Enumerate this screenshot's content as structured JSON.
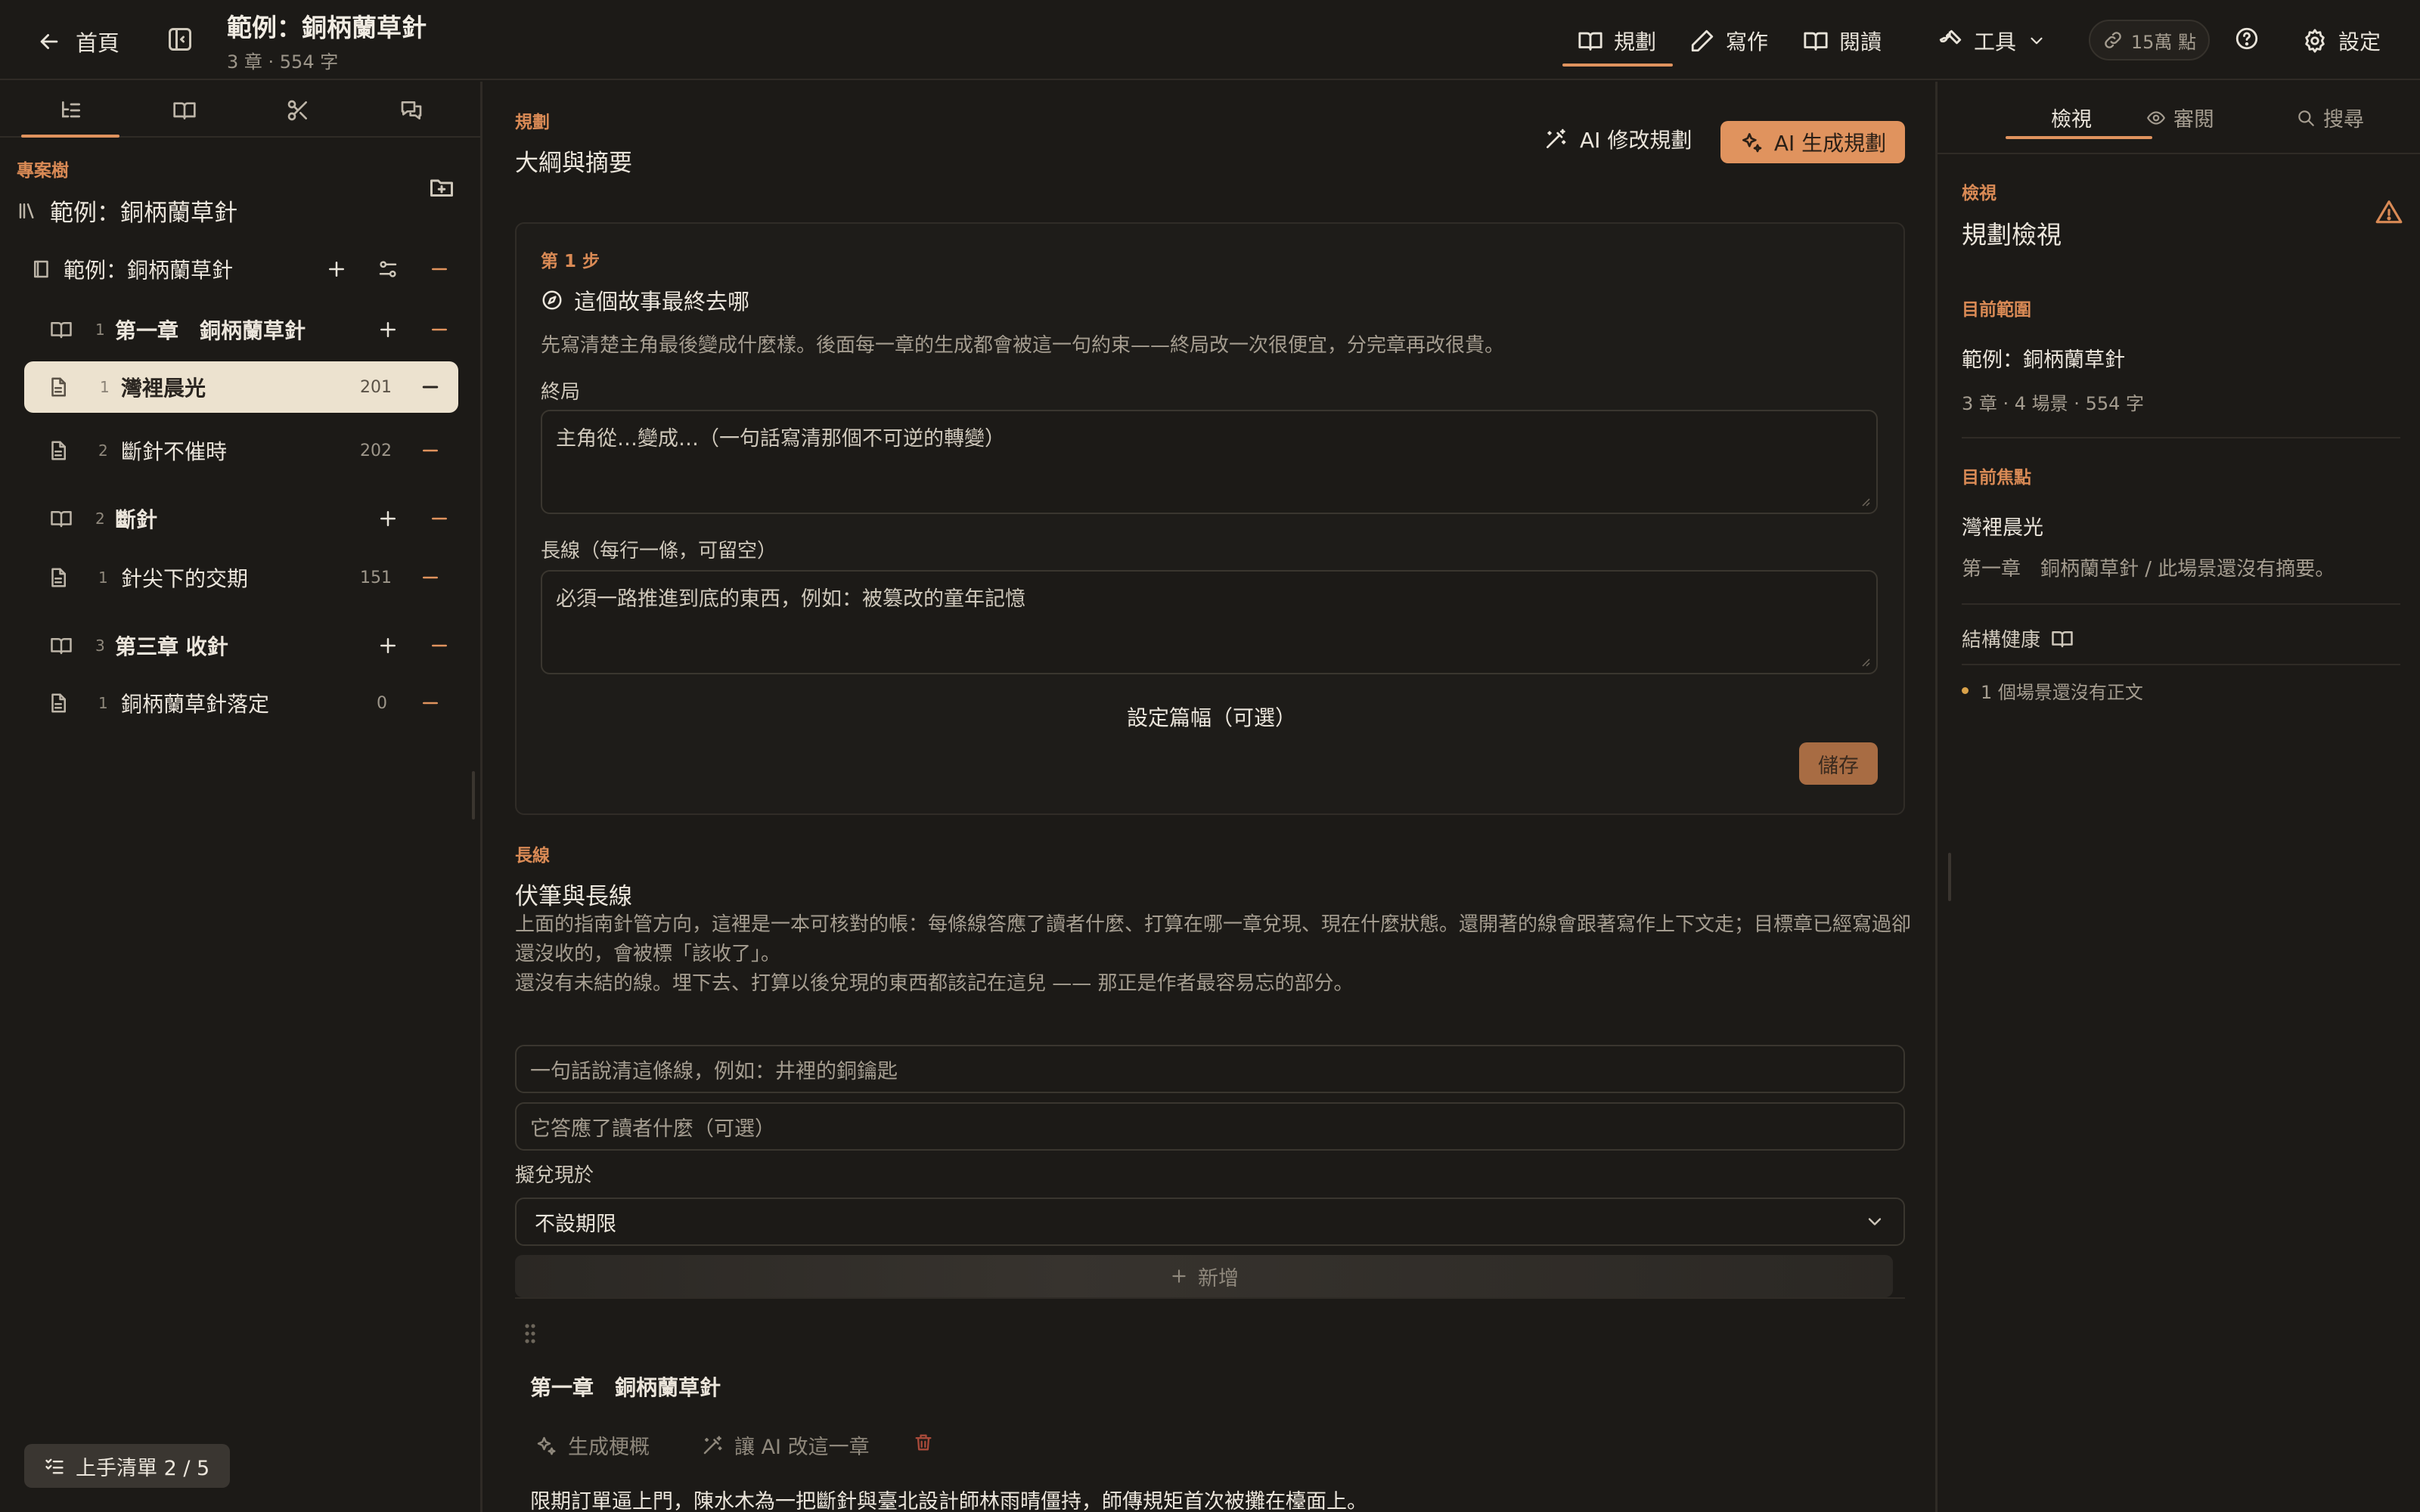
{
  "topbar": {
    "back_label": "首頁",
    "doc_title": "範例：銅柄蘭草針",
    "doc_meta": "3 章 · 554 字",
    "nav": {
      "plan": "規劃",
      "write": "寫作",
      "read": "閱讀",
      "tools": "工具",
      "credits": "15萬 點",
      "settings": "設定"
    }
  },
  "sidebar": {
    "section_label": "專案樹",
    "project_name": "範例：銅柄蘭草針",
    "book": {
      "title": "範例：銅柄蘭草針"
    },
    "tree": [
      {
        "kind": "chapter",
        "num": "1",
        "title": "第一章　銅柄蘭草針"
      },
      {
        "kind": "scene",
        "num": "1",
        "title": "灣裡晨光",
        "count": "201",
        "selected": true
      },
      {
        "kind": "scene",
        "num": "2",
        "title": "斷針不催時",
        "count": "202"
      },
      {
        "kind": "chapter",
        "num": "2",
        "title": "斷針"
      },
      {
        "kind": "scene",
        "num": "1",
        "title": "針尖下的交期",
        "count": "151"
      },
      {
        "kind": "chapter",
        "num": "3",
        "title": "第三章 收針"
      },
      {
        "kind": "scene",
        "num": "1",
        "title": "銅柄蘭草針落定",
        "count": "0"
      }
    ],
    "checklist_label": "上手清單 2 / 5"
  },
  "main": {
    "section_label": "規劃",
    "section_title": "大綱與摘要",
    "ai_edit_label": "AI 修改規劃",
    "ai_generate_label": "AI 生成規劃",
    "step": {
      "label": "第 1 步",
      "question": "這個故事最終去哪",
      "description": "先寫清楚主角最後變成什麼樣。後面每一章的生成都會被這一句約束——終局改一次很便宜，分完章再改很貴。",
      "ending_label": "終局",
      "ending_placeholder": "主角從…變成…（一句話寫清那個不可逆的轉變）",
      "threads_label": "長線（每行一條，可留空）",
      "threads_placeholder": "必須一路推進到底的東西，例如：被篡改的童年記憶",
      "length_link": "設定篇幅（可選）",
      "save_label": "儲存"
    },
    "threads": {
      "label": "長線",
      "title": "伏筆與長線",
      "desc_1": "上面的指南針管方向，這裡是一本可核對的帳：每條線答應了讀者什麼、打算在哪一章兌現、現在什麼狀態。還開著的線會跟著寫作上下文走；目標章已經寫過卻還沒收的，會被標「該收了」。",
      "desc_2": "還沒有未結的線。埋下去、打算以後兌現的東西都該記在這兒 —— 那正是作者最容易忘的部分。",
      "name_placeholder": "一句話說清這條線，例如：井裡的銅鑰匙",
      "promise_placeholder": "它答應了讀者什麼（可選）",
      "payoff_label": "擬兌現於",
      "payoff_value": "不設期限",
      "add_label": "新增"
    },
    "chapter": {
      "title": "第一章　銅柄蘭草針",
      "generate_outline": "生成梗概",
      "ai_revise": "讓 AI 改這一章",
      "summary": "限期訂單逼上門，陳水木為一把斷針與臺北設計師林雨晴僵持，師傳規矩首次被攤在檯面上。"
    }
  },
  "right_panel": {
    "tabs": {
      "view": "檢視",
      "review": "審閱",
      "search": "搜尋"
    },
    "label": "檢視",
    "title": "規劃檢視",
    "scope_label": "目前範圍",
    "scope_name": "範例：銅柄蘭草針",
    "scope_stats": "3 章 · 4 場景 · 554 字",
    "focus_label": "目前焦點",
    "focus_name": "灣裡晨光",
    "focus_desc": "第一章　銅柄蘭草針 / 此場景還沒有摘要。",
    "health_label": "結構健康",
    "health_issue": "1 個場景還沒有正文"
  },
  "colors": {
    "accent": "#e0935e",
    "background": "#1c1a17",
    "selected_row": "#ece2cf",
    "warning_dot": "#d9a24a"
  },
  "icons": [
    "arrow-left-icon",
    "sidebar-toggle-icon",
    "book-open-icon",
    "pen-icon",
    "wrench-icon",
    "chevron-down-icon",
    "link-icon",
    "help-icon",
    "gear-icon",
    "tree-list-icon",
    "scissors-icon",
    "chat-icon",
    "library-icon",
    "folder-plus-icon",
    "book-icon",
    "plus-icon",
    "minus-icon",
    "filter-icon",
    "file-icon",
    "checklist-icon",
    "wand-icon",
    "sparkles-icon",
    "compass-icon",
    "eye-icon",
    "search-icon",
    "warning-icon",
    "drag-handle-icon",
    "trash-icon"
  ]
}
